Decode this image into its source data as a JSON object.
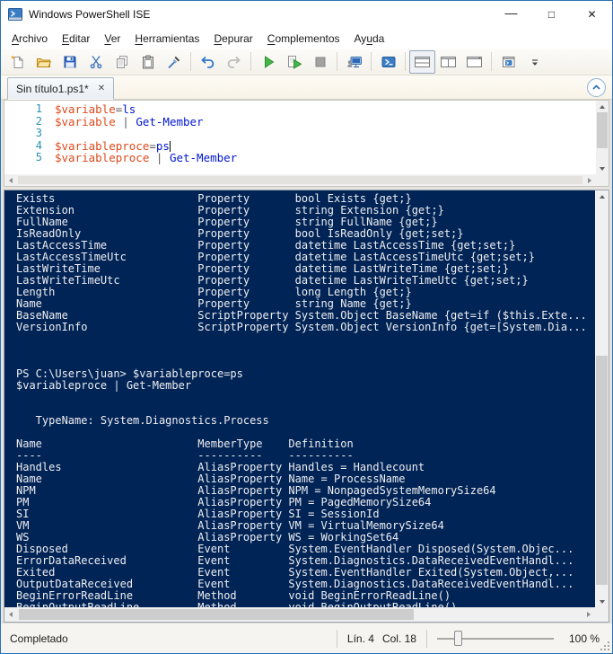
{
  "colors": {
    "accent": "#2a72b5",
    "console_bg": "#012456",
    "console_text": "#efeef1",
    "syntax_variable": "#dd4a1c",
    "syntax_command": "#0016d0",
    "syntax_operator": "#5a5a5a",
    "line_number": "#2b91af",
    "run_green": "#43b649"
  },
  "titlebar": {
    "title": "Windows PowerShell ISE",
    "minimize": "—",
    "maximize": "□",
    "close": "✕"
  },
  "menubar": {
    "items": [
      {
        "name": "archivo",
        "pre": "",
        "key": "A",
        "post": "rchivo"
      },
      {
        "name": "editar",
        "pre": "",
        "key": "E",
        "post": "ditar"
      },
      {
        "name": "ver",
        "pre": "",
        "key": "V",
        "post": "er"
      },
      {
        "name": "herramientas",
        "pre": "",
        "key": "H",
        "post": "erramientas"
      },
      {
        "name": "depurar",
        "pre": "",
        "key": "D",
        "post": "epurar"
      },
      {
        "name": "complementos",
        "pre": "",
        "key": "C",
        "post": "omplementos"
      },
      {
        "name": "ayuda",
        "pre": "Ay",
        "key": "u",
        "post": "da"
      }
    ]
  },
  "toolbar": {
    "groups": [
      [
        {
          "name": "new-script",
          "icon": "new"
        },
        {
          "name": "open-script",
          "icon": "open"
        },
        {
          "name": "save-script",
          "icon": "save"
        },
        {
          "name": "cut",
          "icon": "cut"
        },
        {
          "name": "copy",
          "icon": "copy"
        },
        {
          "name": "paste",
          "icon": "paste"
        },
        {
          "name": "clear-console-pane",
          "icon": "clear"
        }
      ],
      [
        {
          "name": "undo",
          "icon": "undo"
        },
        {
          "name": "redo",
          "icon": "redo"
        }
      ],
      [
        {
          "name": "run-script",
          "icon": "run"
        },
        {
          "name": "run-selection",
          "icon": "run-selection"
        },
        {
          "name": "stop-operation",
          "icon": "stop"
        }
      ],
      [
        {
          "name": "new-remote-powershell-tab",
          "icon": "remote"
        }
      ],
      [
        {
          "name": "start-powershell",
          "icon": "powershell"
        }
      ],
      [
        {
          "name": "show-script-pane-top",
          "icon": "pane-top",
          "selected": true
        },
        {
          "name": "show-script-pane-right",
          "icon": "pane-right"
        },
        {
          "name": "show-script-pane-maximized",
          "icon": "pane-max"
        }
      ],
      [
        {
          "name": "show-command-window",
          "icon": "command-window"
        },
        {
          "name": "toolbar-overflow",
          "icon": "overflow"
        }
      ]
    ]
  },
  "tabbar": {
    "tabs": [
      {
        "label": "Sin título1.ps1*",
        "close": "✕"
      }
    ]
  },
  "editor": {
    "lines": [
      {
        "num": "1",
        "tokens": [
          {
            "c": "v",
            "t": "$variable"
          },
          {
            "c": "o",
            "t": "="
          },
          {
            "c": "k",
            "t": "ls"
          }
        ]
      },
      {
        "num": "2",
        "tokens": [
          {
            "c": "v",
            "t": "$variable"
          },
          {
            "c": "o",
            "t": " | "
          },
          {
            "c": "k",
            "t": "Get-Member"
          }
        ]
      },
      {
        "num": "3",
        "tokens": []
      },
      {
        "num": "4",
        "tokens": [
          {
            "c": "v",
            "t": "$variableproce"
          },
          {
            "c": "o",
            "t": "="
          },
          {
            "c": "k",
            "t": "ps"
          }
        ],
        "cursor": true
      },
      {
        "num": "5",
        "tokens": [
          {
            "c": "v",
            "t": "$variableproce"
          },
          {
            "c": "o",
            "t": " | "
          },
          {
            "c": "k",
            "t": "Get-Member"
          }
        ]
      }
    ]
  },
  "console": {
    "file_members": [
      [
        "Exists",
        "Property",
        "bool Exists {get;}"
      ],
      [
        "Extension",
        "Property",
        "string Extension {get;}"
      ],
      [
        "FullName",
        "Property",
        "string FullName {get;}"
      ],
      [
        "IsReadOnly",
        "Property",
        "bool IsReadOnly {get;set;}"
      ],
      [
        "LastAccessTime",
        "Property",
        "datetime LastAccessTime {get;set;}"
      ],
      [
        "LastAccessTimeUtc",
        "Property",
        "datetime LastAccessTimeUtc {get;set;}"
      ],
      [
        "LastWriteTime",
        "Property",
        "datetime LastWriteTime {get;set;}"
      ],
      [
        "LastWriteTimeUtc",
        "Property",
        "datetime LastWriteTimeUtc {get;set;}"
      ],
      [
        "Length",
        "Property",
        "long Length {get;}"
      ],
      [
        "Name",
        "Property",
        "string Name {get;}"
      ],
      [
        "BaseName",
        "ScriptProperty",
        "System.Object BaseName {get=if ($this.Exte..."
      ],
      [
        "VersionInfo",
        "ScriptProperty",
        "System.Object VersionInfo {get=[System.Dia..."
      ]
    ],
    "prompt_line": "PS C:\\Users\\juan> $variableproce=ps",
    "command_line": "$variableproce | Get-Member",
    "typename": "TypeName: System.Diagnostics.Process",
    "process_table": {
      "headers": [
        "Name",
        "MemberType",
        "Definition"
      ],
      "rows": [
        [
          "Handles",
          "AliasProperty",
          "Handles = Handlecount"
        ],
        [
          "Name",
          "AliasProperty",
          "Name = ProcessName"
        ],
        [
          "NPM",
          "AliasProperty",
          "NPM = NonpagedSystemMemorySize64"
        ],
        [
          "PM",
          "AliasProperty",
          "PM = PagedMemorySize64"
        ],
        [
          "SI",
          "AliasProperty",
          "SI = SessionId"
        ],
        [
          "VM",
          "AliasProperty",
          "VM = VirtualMemorySize64"
        ],
        [
          "WS",
          "AliasProperty",
          "WS = WorkingSet64"
        ],
        [
          "Disposed",
          "Event",
          "System.EventHandler Disposed(System.Objec..."
        ],
        [
          "ErrorDataReceived",
          "Event",
          "System.Diagnostics.DataReceivedEventHandl..."
        ],
        [
          "Exited",
          "Event",
          "System.EventHandler Exited(System.Object,..."
        ],
        [
          "OutputDataReceived",
          "Event",
          "System.Diagnostics.DataReceivedEventHandl..."
        ],
        [
          "BeginErrorReadLine",
          "Method",
          "void BeginErrorReadLine()"
        ],
        [
          "BeginOutputReadLine",
          "Method",
          "void BeginOutputReadLine()"
        ]
      ]
    }
  },
  "statusbar": {
    "status": "Completado",
    "line": "Lín. 4",
    "col": "Col. 18",
    "zoom_percent": "100 %"
  }
}
